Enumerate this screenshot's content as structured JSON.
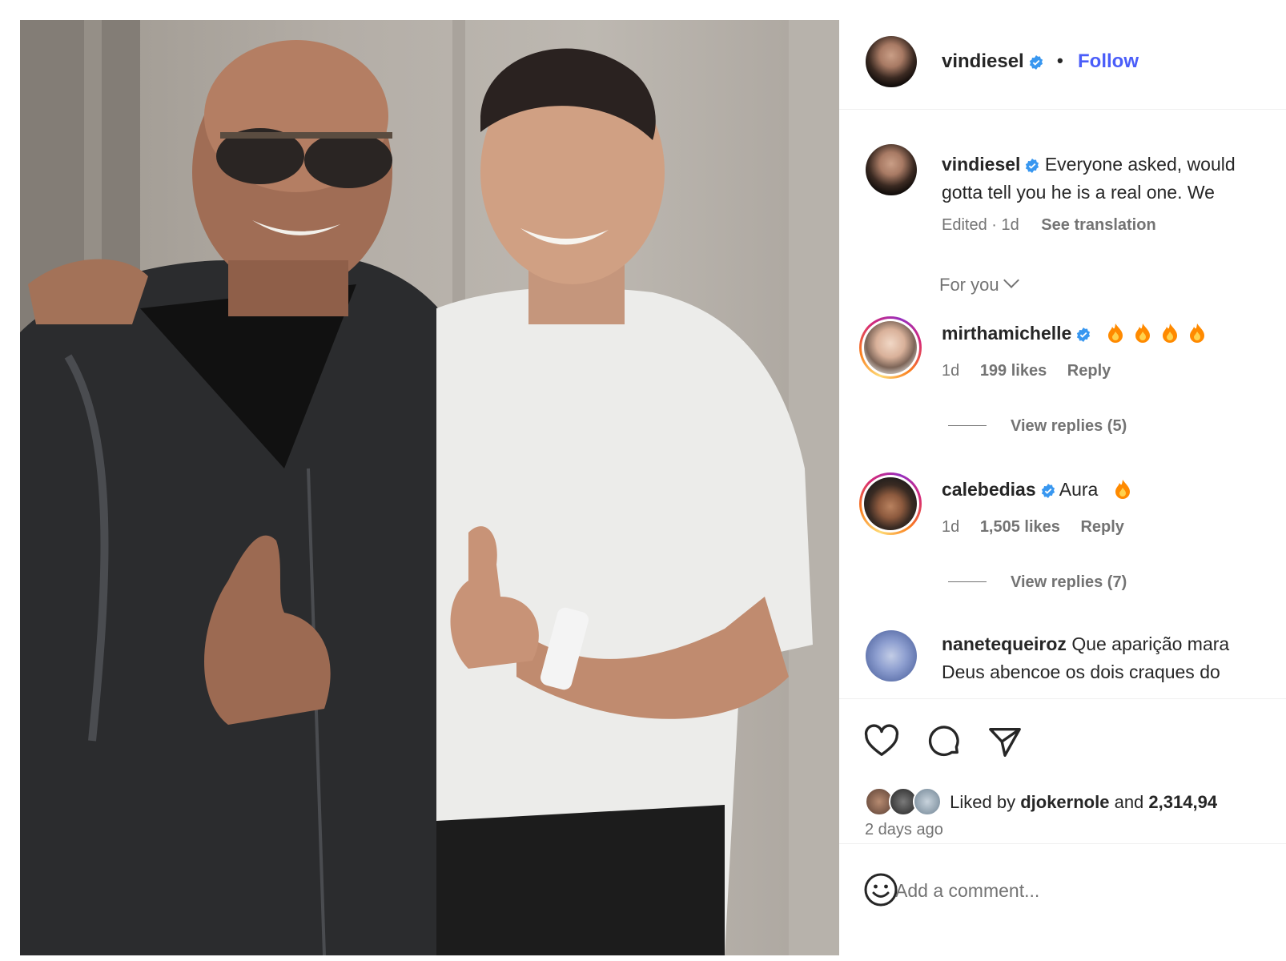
{
  "post": {
    "author": "vindiesel",
    "separator": "•",
    "follow_label": "Follow"
  },
  "caption": {
    "username": "vindiesel",
    "line1": "Everyone asked, would",
    "line2": "gotta tell you he is a real one. We",
    "meta": "Edited · 1d",
    "see_translation": "See translation"
  },
  "filter": {
    "label": "For you"
  },
  "comments": [
    {
      "username": "mirthamichelle",
      "verified": true,
      "text": "",
      "flames": 4,
      "time": "1d",
      "likes": "199 likes",
      "reply": "Reply",
      "view_replies": "View replies (5)"
    },
    {
      "username": "calebedias",
      "verified": true,
      "text": "Aura",
      "flames": 1,
      "time": "1d",
      "likes": "1,505 likes",
      "reply": "Reply",
      "view_replies": "View replies (7)"
    },
    {
      "username": "nanetequeiroz",
      "verified": false,
      "text": "Que aparição mara",
      "text2": "Deus abencoe os dois craques do"
    }
  ],
  "engagement": {
    "liked_by_prefix": "Liked by",
    "liked_by_user": "djokernole",
    "liked_by_and": "and",
    "liked_by_count": "2,314,94",
    "posted_ago": "2 days ago"
  },
  "composer": {
    "placeholder": "Add a comment..."
  },
  "colors": {
    "link": "#4a5df9",
    "verified": "#3897f0",
    "muted": "#737373",
    "flame": "#ff8a00"
  },
  "icons": [
    "heart-icon",
    "comment-icon",
    "share-icon",
    "emoji-icon",
    "verified-badge-icon",
    "flame-icon",
    "chevron-down-icon"
  ]
}
